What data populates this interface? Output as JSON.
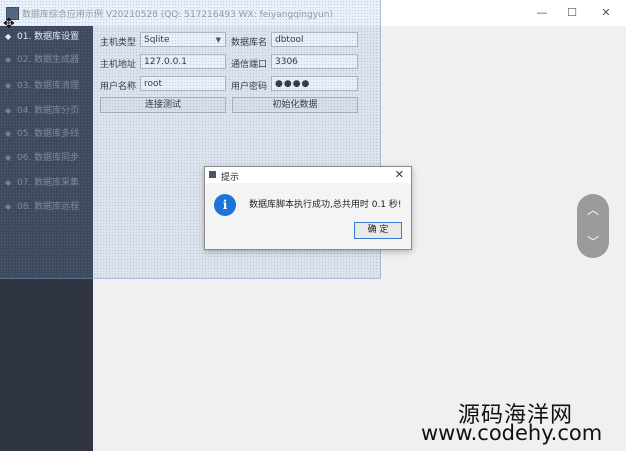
{
  "window": {
    "title": "数据库综合应用示例 V20210528 (QQ: 517216493 WX: feiyangqingyun)",
    "minimize": "—",
    "maximize": "☐",
    "close": "✕"
  },
  "sidebar": {
    "items": [
      {
        "label": "01. 数据库设置"
      },
      {
        "label": "02. 数据生成器"
      },
      {
        "label": "03. 数据库清理"
      },
      {
        "label": "04. 数据库分页"
      },
      {
        "label": "05. 数据库多线"
      },
      {
        "label": "06. 数据库同步"
      },
      {
        "label": "07. 数据库采集"
      },
      {
        "label": "08. 数据库远程"
      }
    ],
    "active_index": 0
  },
  "form": {
    "host_type_label": "主机类型",
    "host_type_value": "Sqlite",
    "db_name_label": "数据库名",
    "db_name_value": "dbtool",
    "host_addr_label": "主机地址",
    "host_addr_value": "127.0.0.1",
    "port_label": "通信端口",
    "port_value": "3306",
    "username_label": "用户名称",
    "username_value": "root",
    "password_label": "用户密码",
    "password_value": "●●●●",
    "test_button": "连接测试",
    "init_button": "初始化数据"
  },
  "dialog": {
    "title": "提示",
    "close": "✕",
    "message": "数据库脚本执行成功,总共用时 0.1 秒!",
    "ok_button": "确 定",
    "icon_letter": "i"
  },
  "scroll": {
    "up": "︿",
    "down": "﹀"
  },
  "watermark": {
    "cn": "源码海洋网",
    "url": "www.codehy.com"
  },
  "colors": {
    "sidebar": "#2e3440",
    "info_icon": "#1e73d8",
    "ok_border": "#3b78d4"
  }
}
